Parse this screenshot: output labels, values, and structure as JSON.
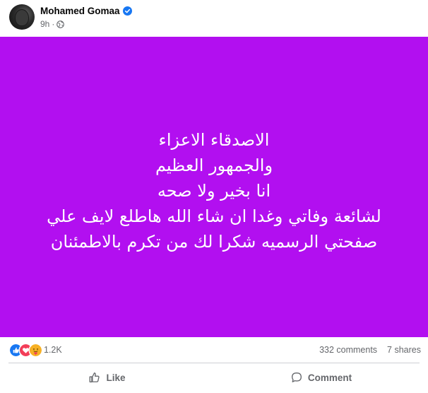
{
  "post": {
    "author": "Mohamed Gomaa",
    "time": "9h",
    "privacy_icon": "globe-icon",
    "background_color": "#b20ff0",
    "text_lines": [
      "الاصدقاء الاعزاء",
      "والجمهور العظيم",
      "انا بخير ولا صحه",
      "لشائعة وفاتي وغدا ان شاء الله هاطلع لايف علي",
      "صفحتي الرسميه شكرا لك من تكرم بالاطمئنان"
    ]
  },
  "stats": {
    "reactions_count": "1.2K",
    "reaction_icons": [
      "like-icon",
      "love-icon",
      "care-icon"
    ],
    "comments": "332 comments",
    "shares": "7 shares"
  },
  "actions": {
    "like_label": "Like",
    "comment_label": "Comment"
  },
  "colors": {
    "accent": "#1877f2",
    "love": "#f33e58",
    "care": "#f7b125"
  }
}
